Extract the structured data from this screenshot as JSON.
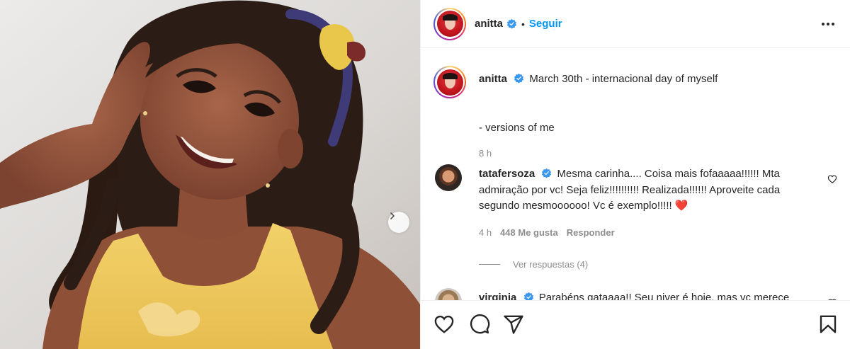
{
  "post": {
    "photo": {
      "alt": "",
      "next_icon": "chevron-right-icon"
    },
    "header": {
      "username": "anitta",
      "verified_icon": "verified-badge-icon",
      "separator": "•",
      "follow_label": "Seguir",
      "more_icon": "more-horizontal-icon"
    },
    "caption": {
      "username": "anitta",
      "text": "March 30th - internacional day of myself",
      "line2": "- versions of me",
      "time": "8 h"
    },
    "comments": [
      {
        "username": "tatafersoza",
        "text": "Mesma carinha.... Coisa mais fofaaaaa!!!!!! Mta admiração por vc! Seja feliz!!!!!!!!!! Realizada!!!!!! Aproveite cada segundo mesmoooooo! Vc é exemplo!!!!!",
        "emoji": "❤️",
        "time": "4 h",
        "likes": "448 Me gusta",
        "reply_label": "Responder",
        "view_replies": "Ver respuestas (4)"
      },
      {
        "username": "virginia",
        "text": "Parabéns gataaaa!! Seu niver é hoje, mas vc merece"
      }
    ],
    "actions": {
      "like_icon": "heart-icon",
      "comment_icon": "comment-icon",
      "share_icon": "share-icon",
      "save_icon": "bookmark-icon"
    },
    "colors": {
      "accent": "#0095f6",
      "text": "#262626",
      "secondary": "#8e8e8e",
      "border": "#efefef",
      "heart": "#ed4956"
    }
  }
}
